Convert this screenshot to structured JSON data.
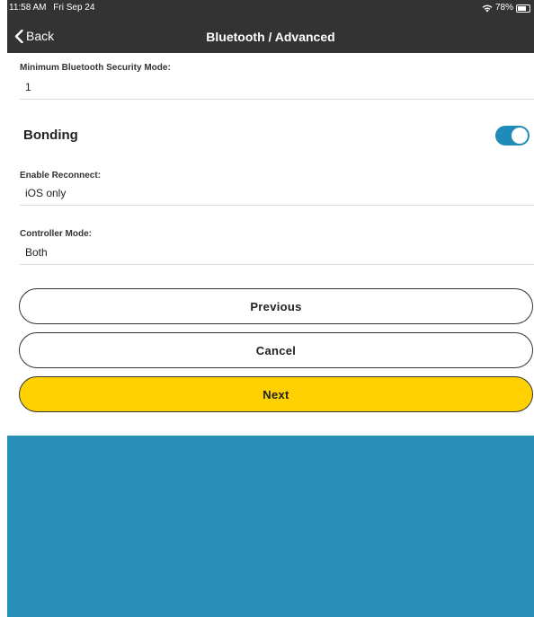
{
  "status_bar": {
    "time": "11:58 AM",
    "date": "Fri Sep 24",
    "wifi_icon": "wifi-icon",
    "battery_percent": "78%",
    "battery_level": 0.78
  },
  "nav": {
    "back_label": "Back",
    "back_icon": "chevron-left-icon",
    "title": "Bluetooth / Advanced"
  },
  "fields": {
    "min_security": {
      "label": "Minimum Bluetooth Security Mode:",
      "value": "1"
    },
    "bonding": {
      "label": "Bonding",
      "enabled": true
    },
    "enable_reconnect": {
      "label": "Enable Reconnect:",
      "value": "iOS only"
    },
    "controller_mode": {
      "label": "Controller Mode:",
      "value": "Both"
    }
  },
  "buttons": {
    "previous": "Previous",
    "cancel": "Cancel",
    "next": "Next"
  },
  "colors": {
    "bars": "#333333",
    "accent": "#1f8bb8",
    "next_button": "#ffd100",
    "bottom_panel": "#2a8fb8"
  }
}
